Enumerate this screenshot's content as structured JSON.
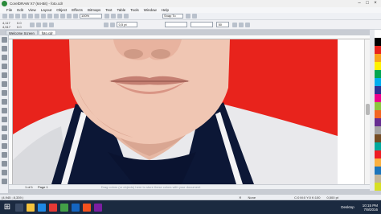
{
  "window": {
    "title": "CorelDRAW X7 (64-Bit) - foto.cdr"
  },
  "menu": [
    "File",
    "Edit",
    "View",
    "Layout",
    "Object",
    "Effects",
    "Bitmaps",
    "Text",
    "Table",
    "Tools",
    "Window",
    "Help"
  ],
  "toolbar": {
    "zoom": "100%",
    "snap": "Snap To"
  },
  "property_bar": {
    "x": "4,117",
    "y": "4,517",
    "w": "0.0",
    "h": "0.0",
    "outline": "0,5 pt",
    "angle": "50"
  },
  "tabs": [
    {
      "label": "Welcome Screen",
      "active": false
    },
    {
      "label": "foto.cdr",
      "active": true
    }
  ],
  "pager": {
    "page_info": "1 of 1",
    "page_label": "Page 1",
    "hint": "Drag colors (or objects) here to store these colors with your document"
  },
  "status": {
    "coords": "(4,945 ; 8,339 )",
    "fill": "None",
    "color_mode": "C:0 M:0 Y:0 K:100",
    "outline": "0,500 pt"
  },
  "taskbar": {
    "desktop_label": "Desktop",
    "time": "10:15 PM",
    "date": "7/9/2016"
  },
  "palette_colors": [
    "#ffffff",
    "#000000",
    "#e8231c",
    "#f8a31b",
    "#fff200",
    "#00a651",
    "#00aeef",
    "#2e3192",
    "#ec008c",
    "#8dc63f",
    "#f26522",
    "#662d91",
    "#a3a3a3",
    "#754c24",
    "#00a99d",
    "#ed1c24",
    "#fbb040",
    "#1b75bc",
    "#c2b59b",
    "#d7df23"
  ]
}
